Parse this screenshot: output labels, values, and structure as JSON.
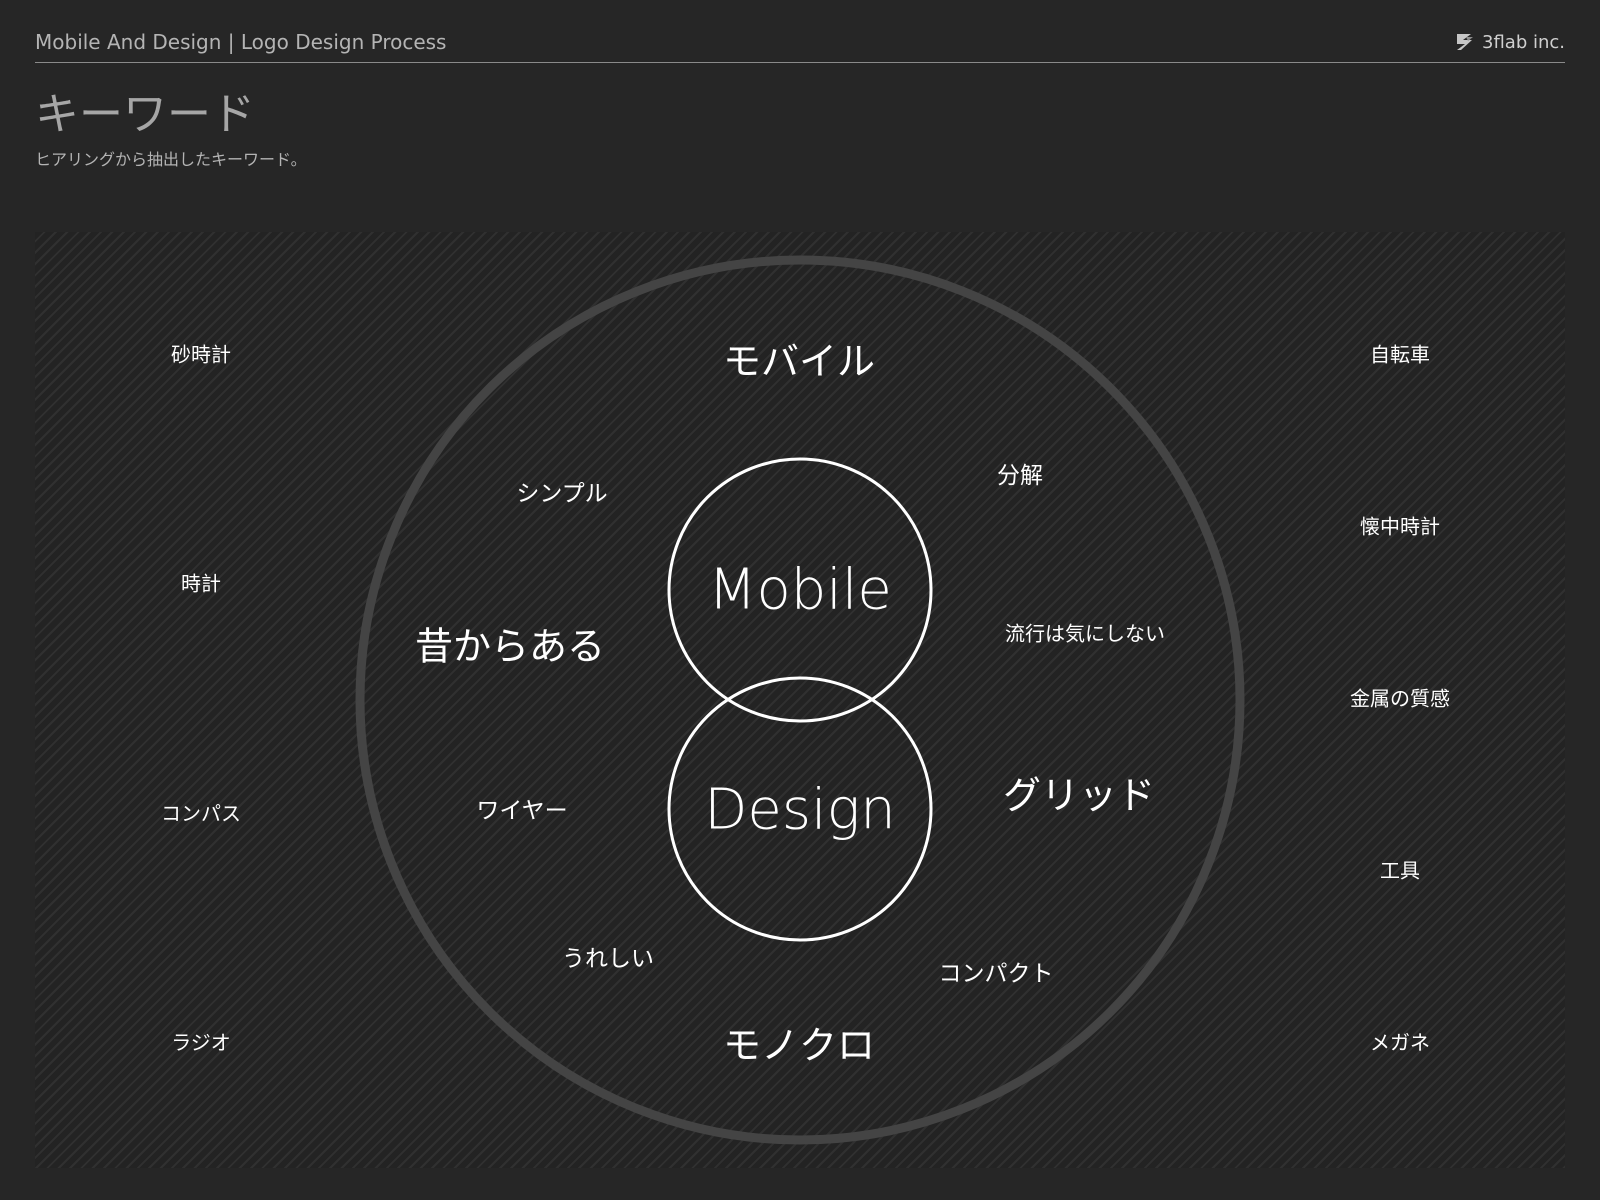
{
  "header": {
    "title": "Mobile And Design | Logo Design Process",
    "brand_name": "3flab inc.",
    "brand_icon": "3flab-logo-icon"
  },
  "page": {
    "title": "キーワード",
    "subtitle": "ヒアリングから抽出したキーワード。"
  },
  "diagram": {
    "circles": {
      "top_label": "Mobile",
      "bottom_label": "Design"
    },
    "inner_keywords": {
      "mobile": "モバイル",
      "simple": "シンプル",
      "bunkai": "分解",
      "mukashi": "昔からある",
      "ryuko": "流行は気にしない",
      "wire": "ワイヤー",
      "grid": "グリッド",
      "ureshii": "うれしい",
      "compact": "コンパクト",
      "monochro": "モノクロ"
    },
    "left_keywords": [
      "砂時計",
      "時計",
      "コンパス",
      "ラジオ"
    ],
    "right_keywords": [
      "自転車",
      "懐中時計",
      "金属の質感",
      "工具",
      "メガネ"
    ]
  },
  "colors": {
    "background": "#262626",
    "outer_ring": "#444444",
    "circle_stroke": "#ffffff",
    "text": "#ffffff",
    "header_text": "#b4b4b4"
  }
}
